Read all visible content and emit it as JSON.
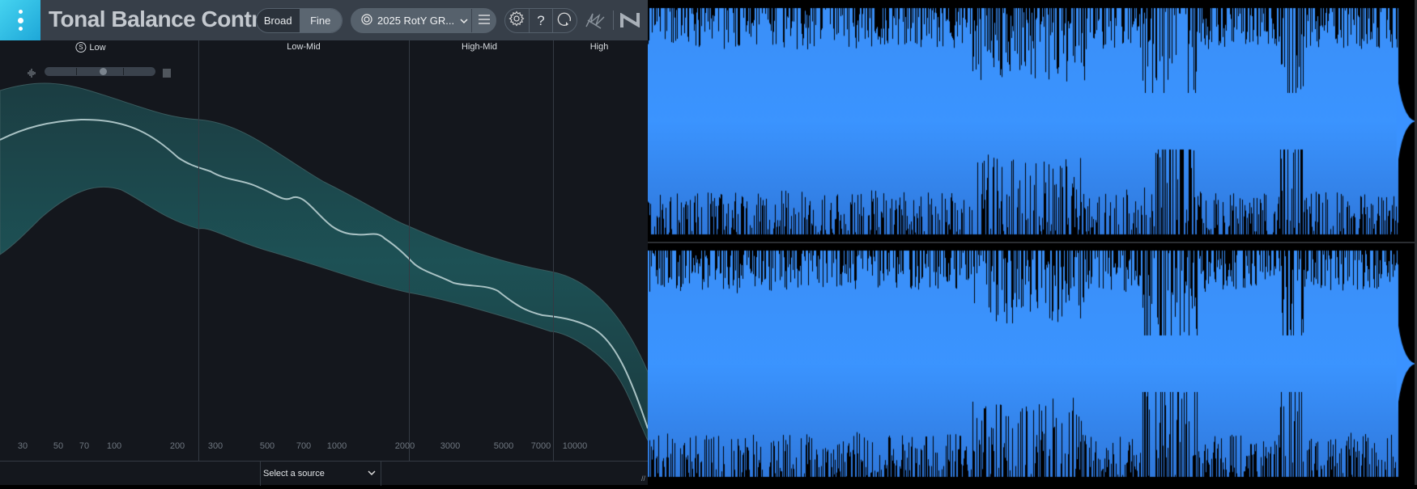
{
  "app": {
    "title": "Tonal Balance Control"
  },
  "header": {
    "mode": {
      "options": [
        "Broad",
        "Fine"
      ],
      "selected": "Fine"
    },
    "preset": {
      "label": "2025 RotY GR...",
      "icon": "target-icon"
    },
    "menu_icon": "hamburger-icon",
    "tools": [
      {
        "icon": "gear-icon"
      },
      {
        "label": "?",
        "icon": "help-icon"
      },
      {
        "icon": "loop-icon"
      }
    ],
    "ozone_icon": "squiggle-icon",
    "brand_icon": "ni-logo"
  },
  "bands": [
    {
      "label": "Low",
      "solo": "S"
    },
    {
      "label": "Low-Mid"
    },
    {
      "label": "High-Mid"
    },
    {
      "label": "High"
    }
  ],
  "frequency_ticks": [
    "30",
    "50",
    "70",
    "100",
    "200",
    "300",
    "500",
    "700",
    "1000",
    "2000",
    "3000",
    "5000",
    "7000",
    "10000"
  ],
  "footer": {
    "source_select": "Select a source"
  },
  "colors": {
    "accent": "#1ea7d8",
    "band_fill": "#1c4a4d",
    "curve": "#a9c2c4",
    "waveform": "#3a92ff",
    "background": "#14171d",
    "header": "#373f49"
  }
}
